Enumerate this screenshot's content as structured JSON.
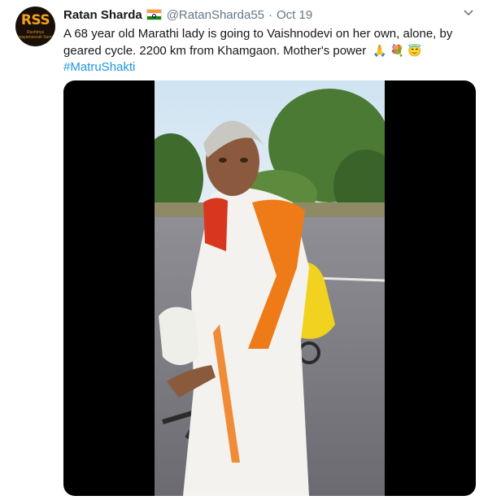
{
  "tweet": {
    "author_name": "Ratan Sharda",
    "flag_icon": "india-flag-icon",
    "handle": "@RatanSharda55",
    "separator": "·",
    "date": "Oct 19",
    "text": "A 68 year old Marathi lady is going to Vaishnodevi on her own, alone, by geared cycle. 2200 km from Khamgaon. Mother's power",
    "hashtag": "#MatruShakti",
    "emojis": [
      "🙏",
      "💐",
      "😇"
    ],
    "avatar_text": "RSS",
    "avatar_subtext": "Rashtriya Swayamsevak Sangh",
    "menu_icon": "chevron-down-icon"
  },
  "colors": {
    "link": "#1b95e0",
    "muted": "#657786",
    "text": "#14171a",
    "video_background": "#000000"
  }
}
